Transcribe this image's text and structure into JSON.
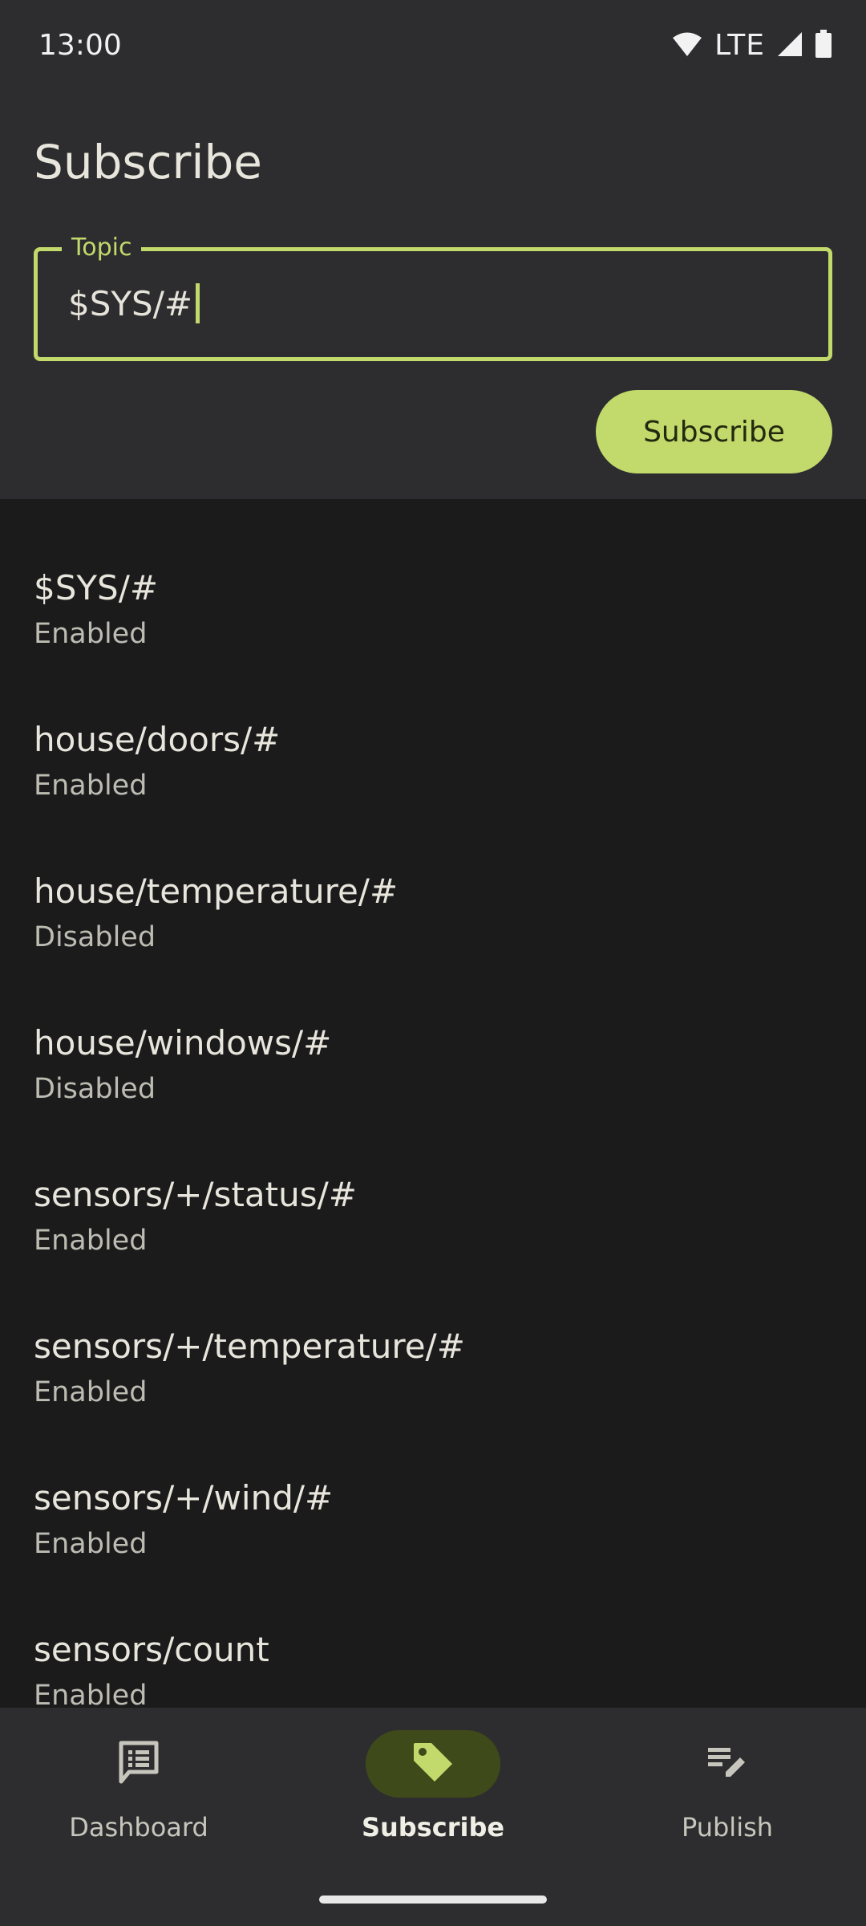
{
  "status_bar": {
    "time": "13:00",
    "network": "LTE",
    "icons": [
      "wifi-icon",
      "signal-icon",
      "battery-icon"
    ]
  },
  "header": {
    "title": "Subscribe"
  },
  "topic_field": {
    "label": "Topic",
    "value": "$SYS/#"
  },
  "subscribe_button": {
    "label": "Subscribe"
  },
  "subscriptions": [
    {
      "topic": "$SYS/#",
      "status": "Enabled"
    },
    {
      "topic": "house/doors/#",
      "status": "Enabled"
    },
    {
      "topic": "house/temperature/#",
      "status": "Disabled"
    },
    {
      "topic": "house/windows/#",
      "status": "Disabled"
    },
    {
      "topic": "sensors/+/status/#",
      "status": "Enabled"
    },
    {
      "topic": "sensors/+/temperature/#",
      "status": "Enabled"
    },
    {
      "topic": "sensors/+/wind/#",
      "status": "Enabled"
    },
    {
      "topic": "sensors/count",
      "status": "Enabled"
    }
  ],
  "bottom_nav": {
    "items": [
      {
        "label": "Dashboard",
        "icon": "dashboard-icon",
        "active": false
      },
      {
        "label": "Subscribe",
        "icon": "tag-icon",
        "active": true
      },
      {
        "label": "Publish",
        "icon": "publish-edit-icon",
        "active": false
      }
    ]
  },
  "colors": {
    "accent": "#c2d96b",
    "surface": "#2d2d2f",
    "background": "#1b1b1c",
    "active_pill": "#3f4a1a"
  }
}
